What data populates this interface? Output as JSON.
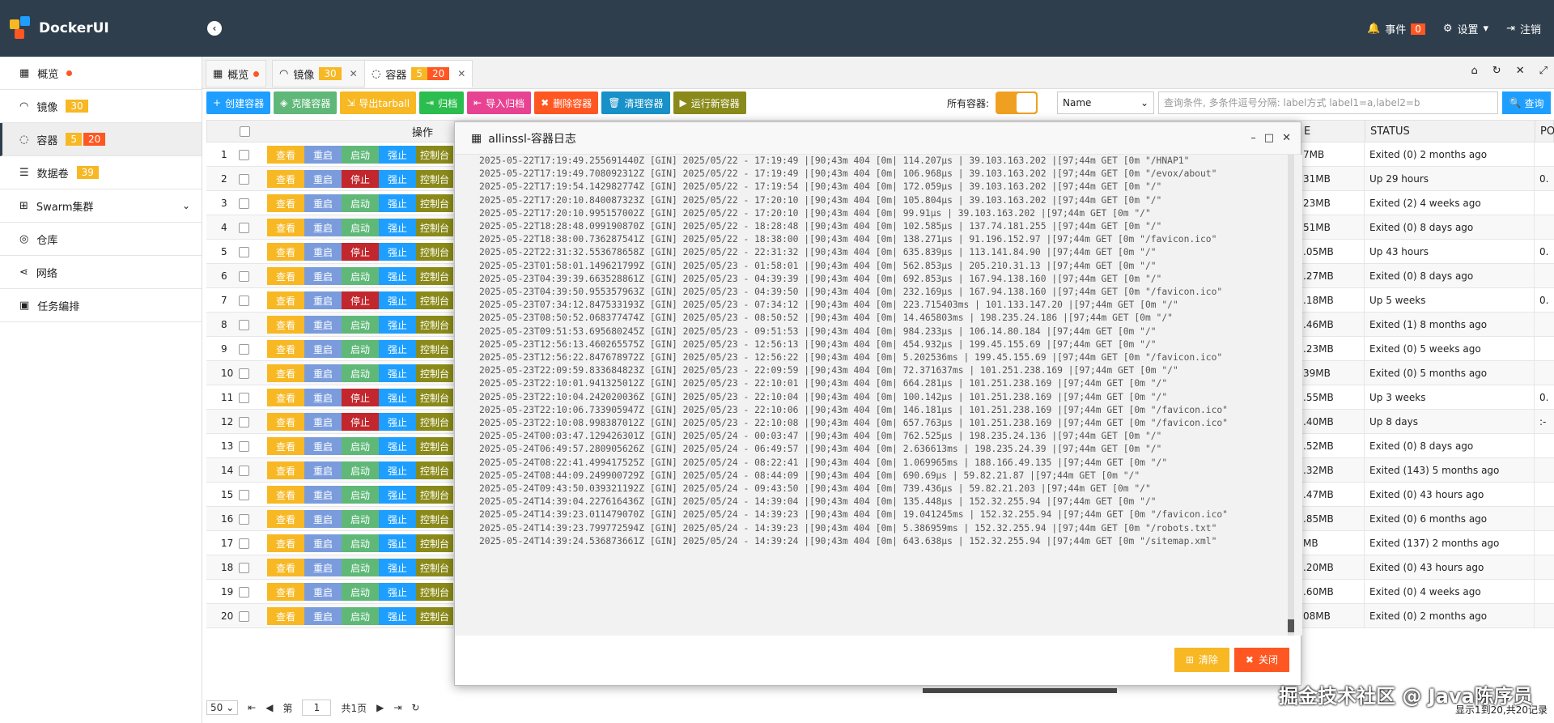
{
  "app": {
    "title": "DockerUI",
    "events_label": "事件",
    "events_count": "0",
    "settings_label": "设置",
    "logout_label": "注销"
  },
  "sidebar": {
    "items": [
      {
        "label": "概览",
        "badge": "",
        "dot": true
      },
      {
        "label": "镜像",
        "badge": "30"
      },
      {
        "label": "容器",
        "badge": "5",
        "badge2": "20"
      },
      {
        "label": "数据卷",
        "badge": "39"
      },
      {
        "label": "Swarm集群",
        "badge": ""
      },
      {
        "label": "仓库",
        "badge": ""
      },
      {
        "label": "网络",
        "badge": ""
      },
      {
        "label": "任务编排",
        "badge": ""
      }
    ]
  },
  "tabs": [
    {
      "label": "概览"
    },
    {
      "label": "镜像",
      "badge": "30"
    },
    {
      "label": "容器",
      "badge": "5",
      "badge2": "20"
    }
  ],
  "toolbar": {
    "create": "创建容器",
    "clone": "克隆容器",
    "export": "导出tarball",
    "archive": "归档",
    "import": "导入归档",
    "delete": "删除容器",
    "clean": "清理容器",
    "run": "运行新容器"
  },
  "filter": {
    "all_label": "所有容器:",
    "select_value": "Name",
    "query_placeholder": "查询条件, 多条件逗号分隔: label方式 label1=a,label2=b",
    "query_button": "查询"
  },
  "table": {
    "headers": {
      "ops": "操作",
      "size_tail": "E",
      "status": "STATUS",
      "ports_tail": "PO"
    },
    "buttons": {
      "view": "查看",
      "restart": "重启",
      "start": "启动",
      "stop": "停止",
      "kill": "强止",
      "console": "控制台"
    },
    "rows": [
      {
        "n": "1",
        "running": false,
        "size": "7MB",
        "status": "Exited (0) 2 months ago",
        "port": ""
      },
      {
        "n": "2",
        "running": true,
        "size": "31MB",
        "status": "Up 29 hours",
        "port": "0."
      },
      {
        "n": "3",
        "running": false,
        "size": "23MB",
        "status": "Exited (2) 4 weeks ago",
        "port": ""
      },
      {
        "n": "4",
        "running": false,
        "size": "51MB",
        "status": "Exited (0) 8 days ago",
        "port": ""
      },
      {
        "n": "5",
        "running": true,
        "size": ".05MB",
        "status": "Up 43 hours",
        "port": "0."
      },
      {
        "n": "6",
        "running": false,
        "size": ".27MB",
        "status": "Exited (0) 8 days ago",
        "port": ""
      },
      {
        "n": "7",
        "running": true,
        "size": ".18MB",
        "status": "Up 5 weeks",
        "port": "0."
      },
      {
        "n": "8",
        "running": false,
        "size": ".46MB",
        "status": "Exited (1) 8 months ago",
        "port": ""
      },
      {
        "n": "9",
        "running": false,
        "size": ".23MB",
        "status": "Exited (0) 5 weeks ago",
        "port": ""
      },
      {
        "n": "10",
        "running": false,
        "size": "39MB",
        "status": "Exited (0) 5 months ago",
        "port": ""
      },
      {
        "n": "11",
        "running": true,
        "size": ".55MB",
        "status": "Up 3 weeks",
        "port": "0."
      },
      {
        "n": "12",
        "running": true,
        "size": ".40MB",
        "status": "Up 8 days",
        "port": ":-"
      },
      {
        "n": "13",
        "running": false,
        "size": ".52MB",
        "status": "Exited (0) 8 days ago",
        "port": ""
      },
      {
        "n": "14",
        "running": false,
        "size": ".32MB",
        "status": "Exited (143) 5 months ago",
        "port": ""
      },
      {
        "n": "15",
        "running": false,
        "size": ".47MB",
        "status": "Exited (0) 43 hours ago",
        "port": ""
      },
      {
        "n": "16",
        "running": false,
        "size": ".85MB",
        "status": "Exited (0) 6 months ago",
        "port": ""
      },
      {
        "n": "17",
        "running": false,
        "size": "MB",
        "status": "Exited (137) 2 months ago",
        "port": ""
      },
      {
        "n": "18",
        "running": false,
        "size": ".20MB",
        "status": "Exited (0) 43 hours ago",
        "port": ""
      },
      {
        "n": "19",
        "running": false,
        "size": ".60MB",
        "status": "Exited (0) 4 weeks ago",
        "port": ""
      },
      {
        "n": "20",
        "running": false,
        "size": "08MB",
        "status": "Exited (0) 2 months ago",
        "port": ""
      }
    ]
  },
  "modal": {
    "title": "allinssl-容器日志",
    "clear": "清除",
    "close": "关闭",
    "lines": [
      "2025-05-22T17:19:49.255691440Z [GIN] 2025/05/22 - 17:19:49 |[90;43m 404 [0m| 114.207µs | 39.103.163.202 |[97;44m GET [0m \"/HNAP1\"",
      "2025-05-22T17:19:49.708092312Z [GIN] 2025/05/22 - 17:19:49 |[90;43m 404 [0m| 106.968µs | 39.103.163.202 |[97;44m GET [0m \"/evox/about\"",
      "2025-05-22T17:19:54.142982774Z [GIN] 2025/05/22 - 17:19:54 |[90;43m 404 [0m| 172.059µs | 39.103.163.202 |[97;44m GET [0m \"/\"",
      "2025-05-22T17:20:10.840087323Z [GIN] 2025/05/22 - 17:20:10 |[90;43m 404 [0m| 105.804µs | 39.103.163.202 |[97;44m GET [0m \"/\"",
      "2025-05-22T17:20:10.995157002Z [GIN] 2025/05/22 - 17:20:10 |[90;43m 404 [0m| 99.91µs | 39.103.163.202 |[97;44m GET [0m \"/\"",
      "2025-05-22T18:28:48.099190870Z [GIN] 2025/05/22 - 18:28:48 |[90;43m 404 [0m| 102.585µs | 137.74.181.255 |[97;44m GET [0m \"/\"",
      "2025-05-22T18:38:00.736287541Z [GIN] 2025/05/22 - 18:38:00 |[90;43m 404 [0m| 138.271µs | 91.196.152.97 |[97;44m GET [0m \"/favicon.ico\"",
      "2025-05-22T22:31:32.553678658Z [GIN] 2025/05/22 - 22:31:32 |[90;43m 404 [0m| 635.839µs | 113.141.84.90 |[97;44m GET [0m \"/\"",
      "2025-05-23T01:58:01.149621799Z [GIN] 2025/05/23 - 01:58:01 |[90;43m 404 [0m| 562.853µs | 205.210.31.13 |[97;44m GET [0m \"/\"",
      "2025-05-23T04:39:39.663528861Z [GIN] 2025/05/23 - 04:39:39 |[90;43m 404 [0m| 692.853µs | 167.94.138.160 |[97;44m GET [0m \"/\"",
      "2025-05-23T04:39:50.955357963Z [GIN] 2025/05/23 - 04:39:50 |[90;43m 404 [0m| 232.169µs | 167.94.138.160 |[97;44m GET [0m \"/favicon.ico\"",
      "2025-05-23T07:34:12.847533193Z [GIN] 2025/05/23 - 07:34:12 |[90;43m 404 [0m| 223.715403ms | 101.133.147.20 |[97;44m GET [0m \"/\"",
      "2025-05-23T08:50:52.068377474Z [GIN] 2025/05/23 - 08:50:52 |[90;43m 404 [0m| 14.465803ms | 198.235.24.186 |[97;44m GET [0m \"/\"",
      "2025-05-23T09:51:53.695680245Z [GIN] 2025/05/23 - 09:51:53 |[90;43m 404 [0m| 984.233µs | 106.14.80.184 |[97;44m GET [0m \"/\"",
      "2025-05-23T12:56:13.460265575Z [GIN] 2025/05/23 - 12:56:13 |[90;43m 404 [0m| 454.932µs | 199.45.155.69 |[97;44m GET [0m \"/\"",
      "2025-05-23T12:56:22.847678972Z [GIN] 2025/05/23 - 12:56:22 |[90;43m 404 [0m| 5.202536ms | 199.45.155.69 |[97;44m GET [0m \"/favicon.ico\"",
      "2025-05-23T22:09:59.833684823Z [GIN] 2025/05/23 - 22:09:59 |[90;43m 404 [0m| 72.371637ms | 101.251.238.169 |[97;44m GET [0m \"/\"",
      "2025-05-23T22:10:01.941325012Z [GIN] 2025/05/23 - 22:10:01 |[90;43m 404 [0m| 664.281µs | 101.251.238.169 |[97;44m GET [0m \"/\"",
      "2025-05-23T22:10:04.242020036Z [GIN] 2025/05/23 - 22:10:04 |[90;43m 404 [0m| 100.142µs | 101.251.238.169 |[97;44m GET [0m \"/\"",
      "2025-05-23T22:10:06.733905947Z [GIN] 2025/05/23 - 22:10:06 |[90;43m 404 [0m| 146.181µs | 101.251.238.169 |[97;44m GET [0m \"/favicon.ico\"",
      "2025-05-23T22:10:08.998387012Z [GIN] 2025/05/23 - 22:10:08 |[90;43m 404 [0m| 657.763µs | 101.251.238.169 |[97;44m GET [0m \"/favicon.ico\"",
      "2025-05-24T00:03:47.129426301Z [GIN] 2025/05/24 - 00:03:47 |[90;43m 404 [0m| 762.525µs | 198.235.24.136 |[97;44m GET [0m \"/\"",
      "2025-05-24T06:49:57.280905626Z [GIN] 2025/05/24 - 06:49:57 |[90;43m 404 [0m| 2.636613ms | 198.235.24.39 |[97;44m GET [0m \"/\"",
      "2025-05-24T08:22:41.499417525Z [GIN] 2025/05/24 - 08:22:41 |[90;43m 404 [0m| 1.069965ms | 188.166.49.135 |[97;44m GET [0m \"/\"",
      "2025-05-24T08:44:09.249900729Z [GIN] 2025/05/24 - 08:44:09 |[90;43m 404 [0m| 690.69µs | 59.82.21.87 |[97;44m GET [0m \"/\"",
      "2025-05-24T09:43:50.039321192Z [GIN] 2025/05/24 - 09:43:50 |[90;43m 404 [0m| 739.436µs | 59.82.21.203 |[97;44m GET [0m \"/\"",
      "2025-05-24T14:39:04.227616436Z [GIN] 2025/05/24 - 14:39:04 |[90;43m 404 [0m| 135.448µs | 152.32.255.94 |[97;44m GET [0m \"/\"",
      "2025-05-24T14:39:23.011479070Z [GIN] 2025/05/24 - 14:39:23 |[90;43m 404 [0m| 19.041245ms | 152.32.255.94 |[97;44m GET [0m \"/favicon.ico\"",
      "2025-05-24T14:39:23.799772594Z [GIN] 2025/05/24 - 14:39:23 |[90;43m 404 [0m| 5.386959ms | 152.32.255.94 |[97;44m GET [0m \"/robots.txt\"",
      "2025-05-24T14:39:24.536873661Z [GIN] 2025/05/24 - 14:39:24 |[90;43m 404 [0m| 643.638µs | 152.32.255.94 |[97;44m GET [0m \"/sitemap.xml\""
    ]
  },
  "pager": {
    "page_size": "50",
    "page_prefix": "第",
    "page": "1",
    "page_suffix": "共1页",
    "summary": "显示1到20,共20记录"
  },
  "watermark": "掘金技术社区 @ Java陈序员"
}
